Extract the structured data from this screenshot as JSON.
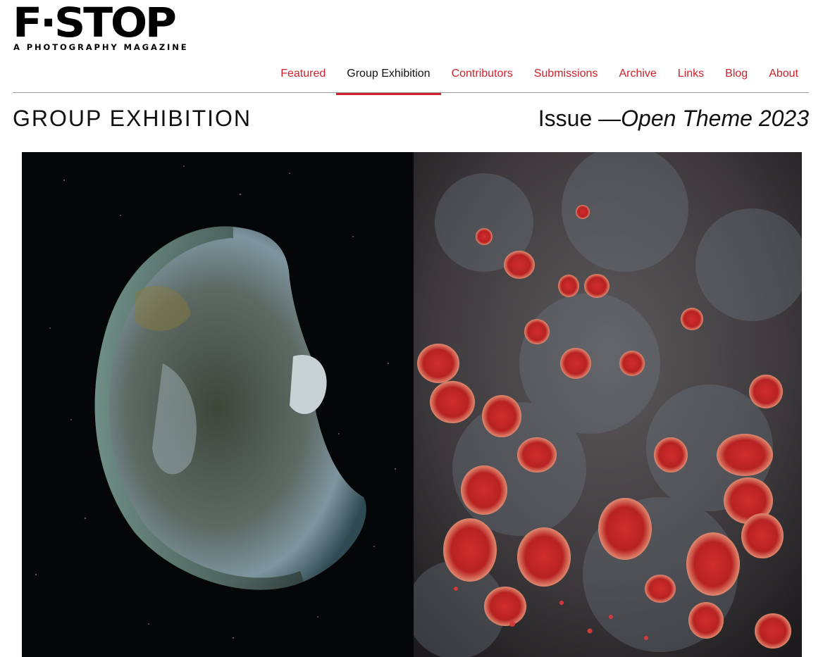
{
  "logo": {
    "mark": "F·STOP",
    "tagline": "A PHOTOGRAPHY MAGAZINE"
  },
  "nav": {
    "items": [
      {
        "label": "Featured"
      },
      {
        "label": "Group Exhibition"
      },
      {
        "label": "Contributors"
      },
      {
        "label": "Submissions"
      },
      {
        "label": "Archive"
      },
      {
        "label": "Links"
      },
      {
        "label": "Blog"
      },
      {
        "label": "About"
      }
    ],
    "active_index": 1
  },
  "page": {
    "title": "GROUP EXHIBITION",
    "issue_prefix": "Issue —",
    "issue_name": "Open Theme 2023"
  },
  "colors": {
    "accent": "#d0202a",
    "text": "#111111",
    "divider": "#9a9a9a"
  }
}
